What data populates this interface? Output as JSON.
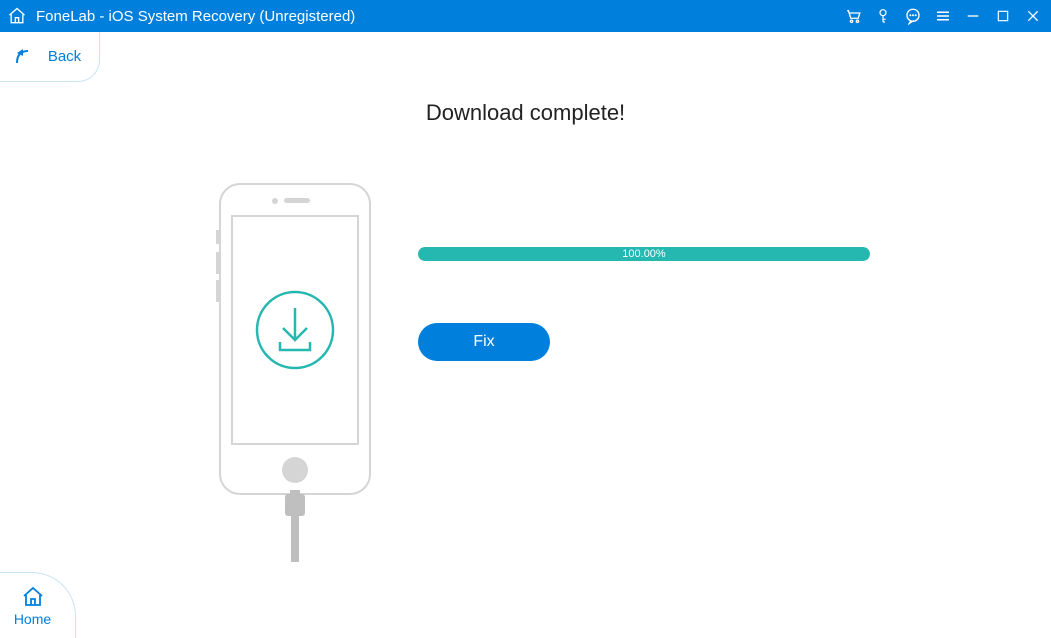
{
  "titlebar": {
    "title": "FoneLab - iOS System Recovery (Unregistered)"
  },
  "nav": {
    "back_label": "Back",
    "home_label": "Home"
  },
  "main": {
    "heading": "Download complete!",
    "progress_text": "100.00%",
    "progress_percent": 100,
    "fix_label": "Fix"
  },
  "colors": {
    "brand": "#0080dc",
    "accent": "#24b8b0"
  }
}
